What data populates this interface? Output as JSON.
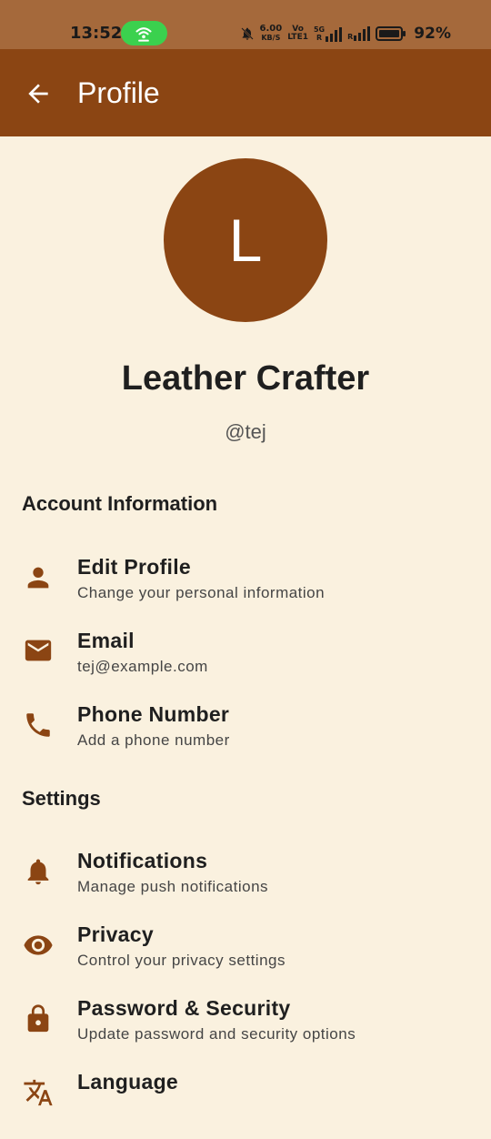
{
  "status_bar": {
    "time": "13:52",
    "net_speed_value": "6.00",
    "net_speed_unit": "KB/S",
    "volte_top": "Vo",
    "volte_bottom": "LTE1",
    "sim1_tag": "5G",
    "sim1_r": "R",
    "sim2_r": "R",
    "battery_percent": "92%",
    "hotspot_color": "#3bd14e"
  },
  "app_bar": {
    "title": "Profile",
    "back_icon": "arrow-left-icon",
    "background": "#8b4513"
  },
  "profile": {
    "avatar_initial": "L",
    "name": "Leather Crafter",
    "handle": "@tej"
  },
  "sections": {
    "account": {
      "title": "Account Information",
      "items": [
        {
          "icon": "person-icon",
          "title": "Edit Profile",
          "subtitle": "Change your personal information"
        },
        {
          "icon": "email-icon",
          "title": "Email",
          "subtitle": "tej@example.com"
        },
        {
          "icon": "phone-icon",
          "title": "Phone Number",
          "subtitle": "Add a phone number"
        }
      ]
    },
    "settings": {
      "title": "Settings",
      "items": [
        {
          "icon": "bell-icon",
          "title": "Notifications",
          "subtitle": "Manage push notifications"
        },
        {
          "icon": "eye-icon",
          "title": "Privacy",
          "subtitle": "Control your privacy settings"
        },
        {
          "icon": "lock-icon",
          "title": "Password & Security",
          "subtitle": "Update password and security options"
        },
        {
          "icon": "translate-icon",
          "title": "Language",
          "subtitle": ""
        }
      ]
    }
  },
  "colors": {
    "accent": "#8b4513",
    "background": "#faf1df",
    "status_bar": "#a5693b"
  }
}
